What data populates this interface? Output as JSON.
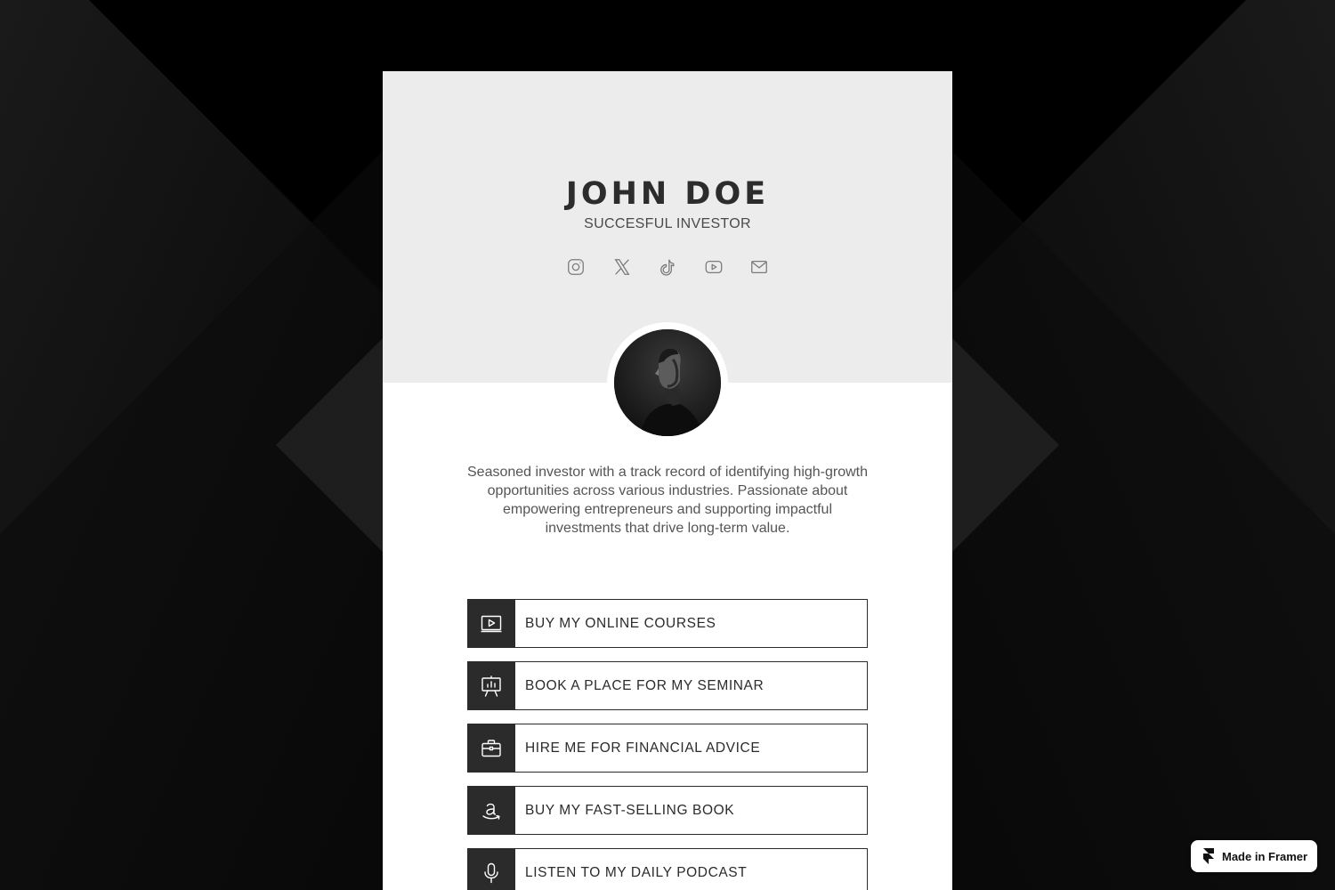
{
  "profile": {
    "name": "JOHN DOE",
    "title": "SUCCESFUL INVESTOR",
    "bio": "Seasoned investor with a track record of identifying high-growth opportunities across various industries. Passionate about empowering entrepreneurs and supporting impactful investments that drive long-term value."
  },
  "socials": [
    {
      "icon": "instagram-icon"
    },
    {
      "icon": "x-twitter-icon"
    },
    {
      "icon": "tiktok-icon"
    },
    {
      "icon": "youtube-icon"
    },
    {
      "icon": "email-icon"
    }
  ],
  "links": [
    {
      "label": "BUY MY ONLINE COURSES",
      "icon": "video-course-icon"
    },
    {
      "label": "BOOK A PLACE FOR MY SEMINAR",
      "icon": "presentation-icon"
    },
    {
      "label": "HIRE ME FOR FINANCIAL ADVICE",
      "icon": "briefcase-icon"
    },
    {
      "label": "BUY MY FAST-SELLING BOOK",
      "icon": "amazon-icon"
    },
    {
      "label": "LISTEN TO MY DAILY PODCAST",
      "icon": "microphone-icon"
    }
  ],
  "badge": {
    "label": "Made in Framer",
    "icon": "framer-logo-icon"
  },
  "colors": {
    "page_background": "#000000",
    "header_background": "#ececec",
    "card_background": "#ffffff",
    "accent_dark": "#2b2b2b",
    "text_muted": "#555555"
  }
}
